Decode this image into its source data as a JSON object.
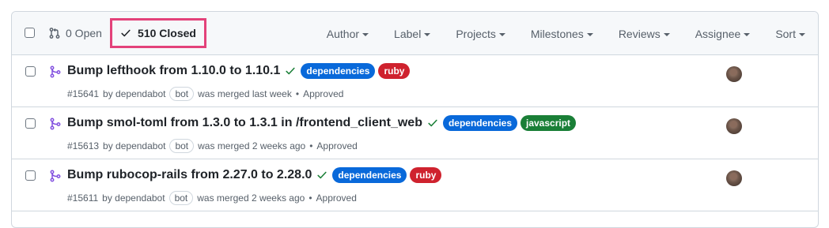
{
  "header": {
    "open_label": "0 Open",
    "closed_label": "510 Closed",
    "filters": [
      {
        "label": "Author"
      },
      {
        "label": "Label"
      },
      {
        "label": "Projects"
      },
      {
        "label": "Milestones"
      },
      {
        "label": "Reviews"
      },
      {
        "label": "Assignee"
      },
      {
        "label": "Sort"
      }
    ]
  },
  "rows": [
    {
      "title": "Bump lefthook from 1.10.0 to 1.10.1",
      "labels": [
        {
          "text": "dependencies",
          "color": "#0969da"
        },
        {
          "text": "ruby",
          "color": "#cf222e"
        }
      ],
      "number": "#15641",
      "by": "by dependabot",
      "bot": "bot",
      "merged": "was merged last week",
      "status": "Approved"
    },
    {
      "title": "Bump smol-toml from 1.3.0 to 1.3.1 in /frontend_client_web",
      "labels": [
        {
          "text": "dependencies",
          "color": "#0969da"
        },
        {
          "text": "javascript",
          "color": "#1a7f37"
        }
      ],
      "number": "#15613",
      "by": "by dependabot",
      "bot": "bot",
      "merged": "was merged 2 weeks ago",
      "status": "Approved"
    },
    {
      "title": "Bump rubocop-rails from 2.27.0 to 2.28.0",
      "labels": [
        {
          "text": "dependencies",
          "color": "#0969da"
        },
        {
          "text": "ruby",
          "color": "#cf222e"
        }
      ],
      "number": "#15611",
      "by": "by dependabot",
      "bot": "bot",
      "merged": "was merged 2 weeks ago",
      "status": "Approved"
    }
  ],
  "colors": {
    "merged_icon": "#8250df",
    "check": "#1a7f37",
    "highlight_border": "#e3427a"
  },
  "icons": {
    "open": "git-pull-request-icon",
    "closed": "check-icon",
    "merged": "git-merge-icon",
    "approved_check": "check-icon"
  }
}
